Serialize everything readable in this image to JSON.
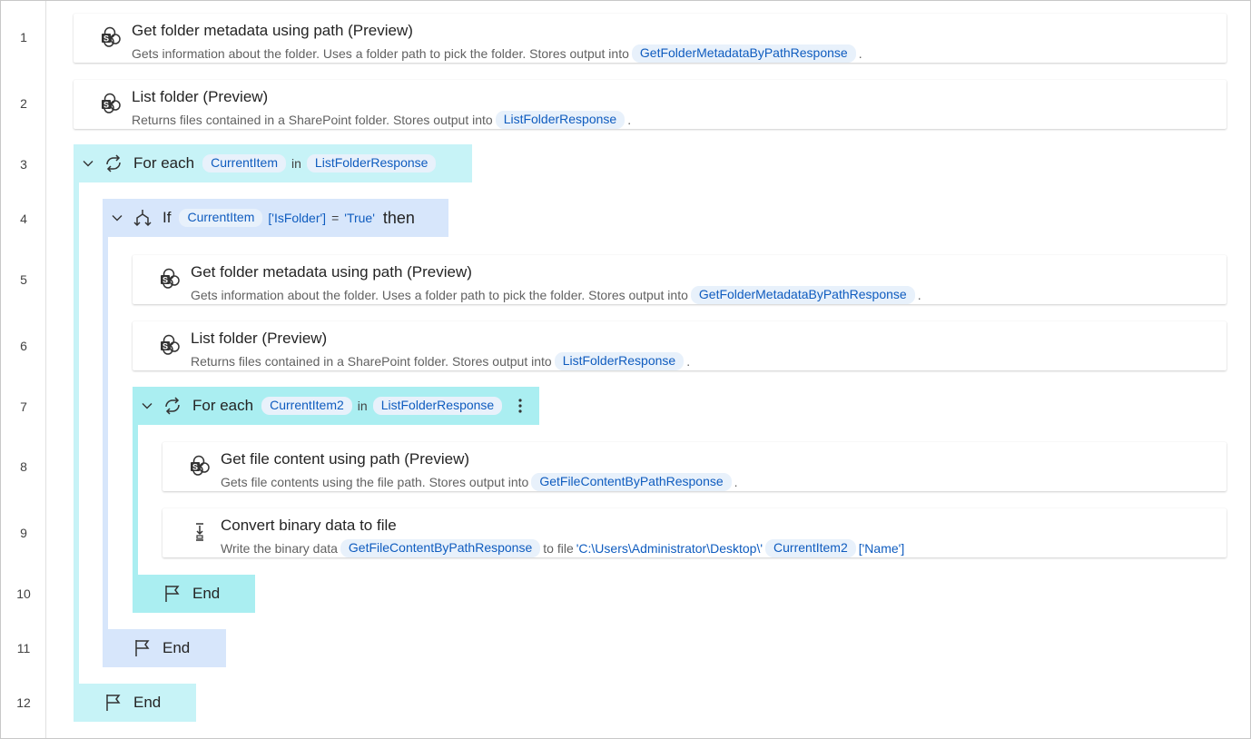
{
  "line_numbers": [
    "1",
    "2",
    "3",
    "4",
    "5",
    "6",
    "7",
    "8",
    "9",
    "10",
    "11",
    "12"
  ],
  "colors": {
    "foreach_bg": "#c7f3f7",
    "foreach_inner_bg": "#aaeef1",
    "if_bg": "#d7e6fb",
    "pill_bg": "#e8f1fb",
    "pill_text": "#0f5cbf"
  },
  "step1": {
    "icon": "sharepoint-icon",
    "title": "Get folder metadata using path (Preview)",
    "desc": "Gets information about the folder. Uses a folder path to pick the folder. Stores output into",
    "var": "GetFolderMetadataByPathResponse",
    "end": "."
  },
  "step2": {
    "icon": "sharepoint-icon",
    "title": "List folder (Preview)",
    "desc": "Returns files contained in a SharePoint folder. Stores output into",
    "var": "ListFolderResponse",
    "end": "."
  },
  "step3": {
    "keyword": "For each",
    "var": "CurrentItem",
    "in": "in",
    "collection": "ListFolderResponse"
  },
  "step4": {
    "keyword": "If",
    "var": "CurrentItem",
    "key": "['IsFolder']",
    "op": "=",
    "value": "'True'",
    "then": "then"
  },
  "step5": {
    "icon": "sharepoint-icon",
    "title": "Get folder metadata using path (Preview)",
    "desc": "Gets information about the folder. Uses a folder path to pick the folder. Stores output into",
    "var": "GetFolderMetadataByPathResponse",
    "end": "."
  },
  "step6": {
    "icon": "sharepoint-icon",
    "title": "List folder (Preview)",
    "desc": "Returns files contained in a SharePoint folder. Stores output into",
    "var": "ListFolderResponse",
    "end": "."
  },
  "step7": {
    "keyword": "For each",
    "var": "CurrentItem2",
    "in": "in",
    "collection": "ListFolderResponse"
  },
  "step8": {
    "icon": "sharepoint-icon",
    "title": "Get file content using path (Preview)",
    "desc": "Gets file contents using the file path. Stores output into",
    "var": "GetFileContentByPathResponse",
    "end": "."
  },
  "step9": {
    "icon": "convert-file-icon",
    "title": "Convert binary data to file",
    "desc_prefix": "Write the binary data",
    "var": "GetFileContentByPathResponse",
    "to_file": "to file",
    "path": "'C:\\Users\\Administrator\\Desktop\\'",
    "var2": "CurrentItem2",
    "key": "['Name']"
  },
  "step10": {
    "keyword": "End"
  },
  "step11": {
    "keyword": "End"
  },
  "step12": {
    "keyword": "End"
  }
}
